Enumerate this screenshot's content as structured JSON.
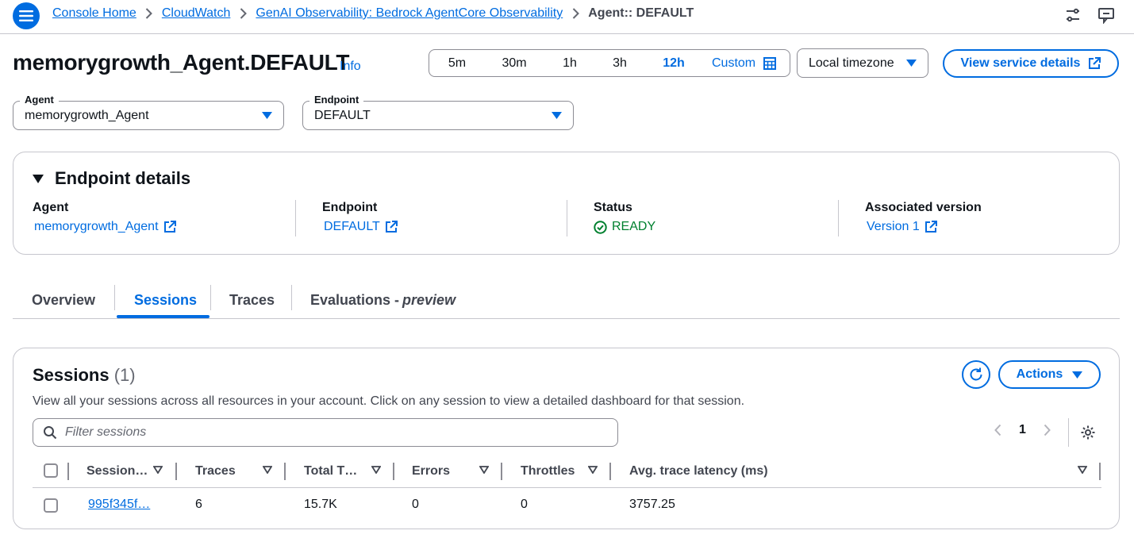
{
  "breadcrumb": {
    "items": [
      "Console Home",
      "CloudWatch",
      "GenAI Observability: Bedrock AgentCore Observability"
    ],
    "current": "Agent:: DEFAULT"
  },
  "top_icons": [
    "settings-sliders-icon",
    "feedback-icon"
  ],
  "page": {
    "title": "memorygrowth_Agent.DEFAULT",
    "info": "Info"
  },
  "time_range": {
    "options": [
      "5m",
      "30m",
      "1h",
      "3h",
      "12h"
    ],
    "selected": "12h",
    "custom": "Custom",
    "timezone": "Local timezone"
  },
  "view_service_button": "View service details",
  "agent_select": {
    "label": "Agent",
    "value": "memorygrowth_Agent"
  },
  "endpoint_select": {
    "label": "Endpoint",
    "value": "DEFAULT"
  },
  "endpoint_details": {
    "heading": "Endpoint details",
    "agent": {
      "label": "Agent",
      "value": "memorygrowth_Agent"
    },
    "endpoint": {
      "label": "Endpoint",
      "value": "DEFAULT"
    },
    "status": {
      "label": "Status",
      "value": "READY"
    },
    "version": {
      "label": "Associated version",
      "value": "Version 1"
    }
  },
  "tabs": {
    "overview": "Overview",
    "sessions": "Sessions",
    "traces": "Traces",
    "evaluations": "Evaluations - ",
    "evaluations_suffix": "preview",
    "active": "Sessions"
  },
  "sessions": {
    "title": "Sessions",
    "count": "(1)",
    "description": "View all your sessions across all resources in your account. Click on any session to view a detailed dashboard for that session.",
    "actions": "Actions",
    "filter_placeholder": "Filter sessions",
    "page": "1",
    "columns": [
      "Session…",
      "Traces",
      "Total T…",
      "Errors",
      "Throttles",
      "Avg. trace latency (ms)"
    ],
    "rows": [
      {
        "session": "995f345f…",
        "traces": "6",
        "total": "15.7K",
        "errors": "0",
        "throttles": "0",
        "latency": "3757.25"
      }
    ]
  },
  "colors": {
    "accent": "#006ce0",
    "success": "#00802f",
    "border": "#c6c6cd"
  }
}
